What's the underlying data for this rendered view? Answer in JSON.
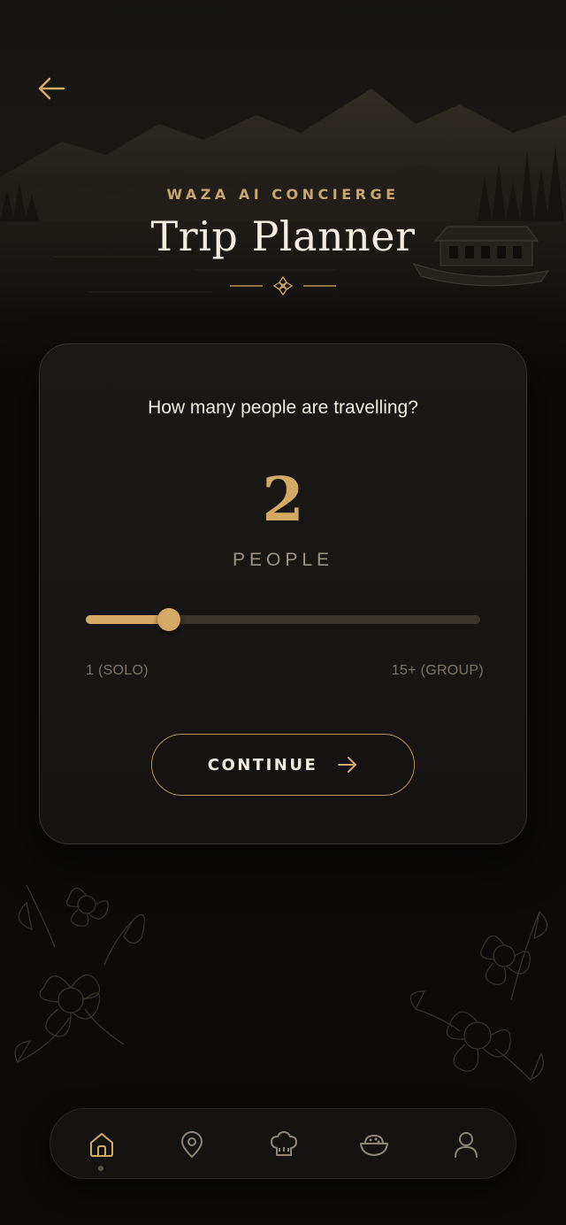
{
  "header": {
    "eyebrow": "WAZA AI CONCIERGE",
    "title": "Trip Planner",
    "back_icon": "arrow-left-icon"
  },
  "card": {
    "question": "How many people are travelling?",
    "count": "2",
    "unit": "PEOPLE",
    "slider": {
      "value": 2,
      "min": 1,
      "max": 15,
      "min_label": "1 (SOLO)",
      "max_label": "15+ (GROUP)"
    },
    "continue_label": "CONTINUE",
    "continue_icon": "arrow-right-icon"
  },
  "nav": {
    "items": [
      {
        "name": "home",
        "icon": "home-icon",
        "active": true
      },
      {
        "name": "location",
        "icon": "map-pin-icon",
        "active": false
      },
      {
        "name": "chef",
        "icon": "chef-hat-icon",
        "active": false
      },
      {
        "name": "food",
        "icon": "food-bowl-icon",
        "active": false
      },
      {
        "name": "profile",
        "icon": "user-icon",
        "active": false
      }
    ]
  },
  "colors": {
    "accent": "#d4a963",
    "background": "#0c0b0a",
    "card": "#1b1916",
    "muted_text": "#7d7466"
  }
}
